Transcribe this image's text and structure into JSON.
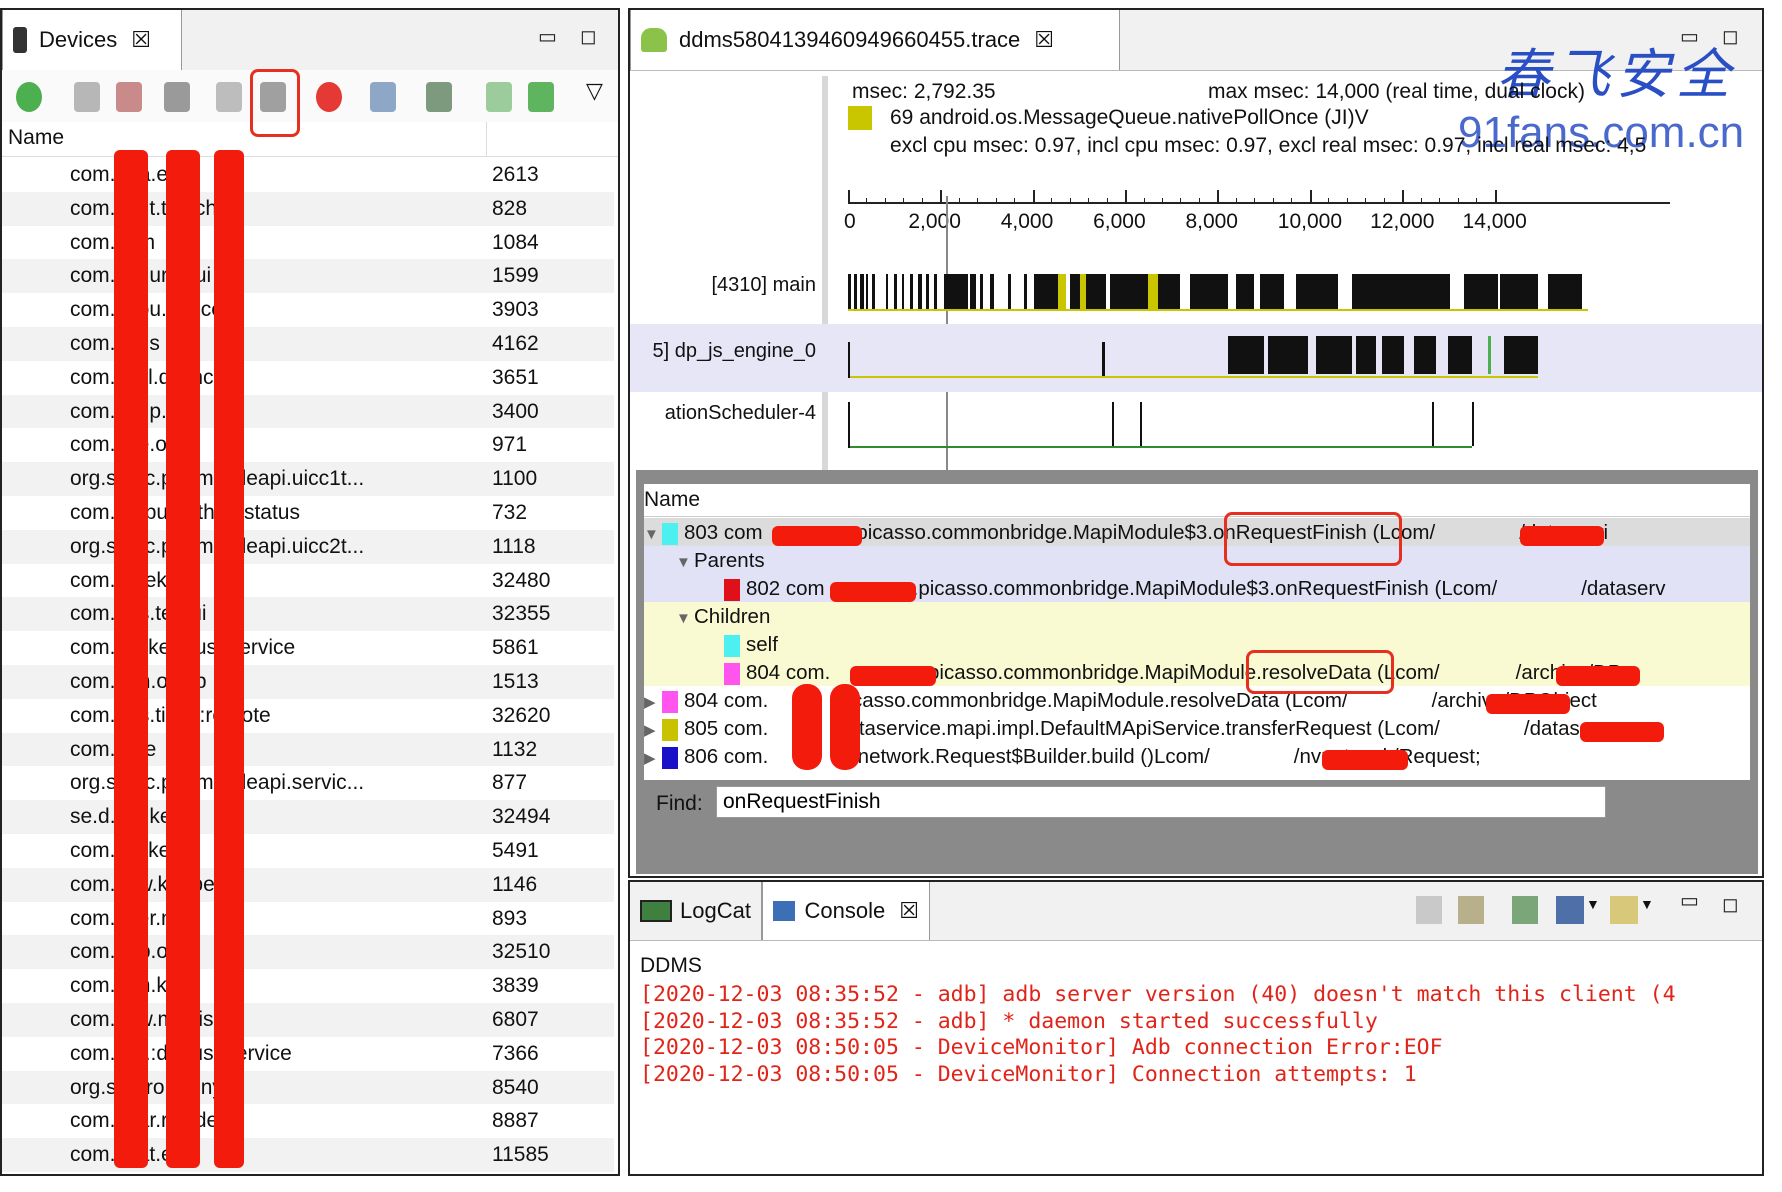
{
  "devices": {
    "tab_label": "Devices",
    "column_name": "Name",
    "rows": [
      {
        "name": "com.m.a.elux",
        "pid": "2613"
      },
      {
        "name": "com.ui.nt.tcatcher",
        "pid": "828"
      },
      {
        "name": "com.ui.m",
        "pid": "1084"
      },
      {
        "name": "com.e.s.ur.miui",
        "pid": "1599"
      },
      {
        "name": "com.ui.ou.ervice",
        "pid": "3903"
      },
      {
        "name": "com.ui.ns",
        "pid": "4162"
      },
      {
        "name": "com.ui.cl.dsync",
        "pid": "3651"
      },
      {
        "name": "com.id.np._mi",
        "pid": "3400"
      },
      {
        "name": "com.ui.e.one",
        "pid": "971"
      },
      {
        "name": "org.s.al.c.penmobileapi.uicc1t...",
        "pid": "1100"
      },
      {
        "name": "com.hu.pu.nethod.status",
        "pid": "732"
      },
      {
        "name": "org.s.al.c.penmobileapi.uicc2t...",
        "pid": "1118"
      },
      {
        "name": "com.ed.ek.ns",
        "pid": "32480"
      },
      {
        "name": "com.dr.s.temui",
        "pid": "32355"
      },
      {
        "name": "com.il.fr.ker:pushservice",
        "pid": "5861"
      },
      {
        "name": "com.o.m.oknlp",
        "pid": "1513"
      },
      {
        "name": "com.dr.s.tings:remote",
        "pid": "32620"
      },
      {
        "name": "com.ui.re",
        "pid": "1132"
      },
      {
        "name": "org.s.al.c.penmobileapi.servic...",
        "pid": "877"
      },
      {
        "name": "se.d.c.a.ker",
        "pid": "32494"
      },
      {
        "name": "com.il.fr.ker",
        "pid": "5491"
      },
      {
        "name": "com.ui.w.keeper",
        "pid": "1146"
      },
      {
        "name": "com.ui.er.n",
        "pid": "893"
      },
      {
        "name": "com.dr.p.one",
        "pid": "32510"
      },
      {
        "name": "com.o.m.ket",
        "pid": "3839"
      },
      {
        "name": "com.pj.w.magisk",
        "pid": "6807"
      },
      {
        "name": "com.n.g.:dppushservice",
        "pid": "7366"
      },
      {
        "name": "org.s.dr.ro.drony",
        "pid": "8540"
      },
      {
        "name": "com.ui.ar.rovider",
        "pid": "8887"
      },
      {
        "name": "com.ui.at.er2",
        "pid": "11585"
      }
    ]
  },
  "trace": {
    "tab_label": "ddms5804139460949660455.trace",
    "watermark_cn": "春飞安全",
    "watermark_url": "91fans.com.cn",
    "info_msec": "msec: 2,792.35",
    "info_max": "max msec: 14,000 (real time, dual clock)",
    "info_method": "69 android.os.MessageQueue.nativePollOnce (JI)V",
    "info_excl": "excl cpu msec: 0.97, incl cpu msec: 0.97, excl real msec: 0.97, incl real msec: 4,5",
    "axis_ticks": [
      "0",
      "2,000",
      "4,000",
      "6,000",
      "8,000",
      "10,000",
      "12,000",
      "14,000"
    ],
    "threads": [
      "[4310] main",
      "5] dp_js_engine_0",
      "ationScheduler-4"
    ],
    "tree_header": "Name",
    "tree_rows": [
      {
        "text": "803 com",
        "rest": ".picasso.commonbridge.MapiModule$3.onRequestFinish (Lcom/",
        "tail": "/dataservi"
      },
      {
        "text": "Parents"
      },
      {
        "text": "802 com",
        "rest": ".picasso.commonbridge.MapiModule$3.onRequestFinish (Lcom/",
        "tail": "/dataserv"
      },
      {
        "text": "Children"
      },
      {
        "text": "self"
      },
      {
        "text": "804 com.",
        "rest": ".picasso.commonbridge.MapiModule.resolveData (Lcom/",
        "tail": "/archive/DP"
      },
      {
        "text": "804 com.",
        "rest": ".picasso.commonbridge.MapiModule.resolveData (Lcom/",
        "tail": "/archive/DPObject"
      },
      {
        "text": "805 com.",
        "rest": ".dataservice.mapi.impl.DefaultMApiService.transferRequest (Lcom/",
        "tail": "/datase"
      },
      {
        "text": "806 com.",
        "rest": ".nvnetwork.Request$Builder.build ()Lcom/",
        "tail": "/nvnetwork/Request;"
      }
    ],
    "find_label": "Find:",
    "find_value": "onRequestFinish"
  },
  "console": {
    "tab_logcat": "LogCat",
    "tab_console": "Console",
    "source": "DDMS",
    "lines": [
      "[2020-12-03 08:35:52 - adb] adb server version (40) doesn't match this client (4",
      "[2020-12-03 08:35:52 - adb] * daemon started successfully",
      "[2020-12-03 08:50:05 - DeviceMonitor] Adb connection Error:EOF",
      "[2020-12-03 08:50:05 - DeviceMonitor] Connection attempts: 1"
    ]
  },
  "colors": {
    "redaction": "#f21b0c",
    "highlight_box": "#e53020",
    "console_text": "#e02419",
    "swatch_cyan": "#4df0f0",
    "swatch_red": "#e0101a",
    "swatch_magenta": "#ff55ee",
    "swatch_olive": "#c8c200",
    "swatch_blue": "#1a10c8",
    "swatch_yellow": "#c9c600"
  }
}
